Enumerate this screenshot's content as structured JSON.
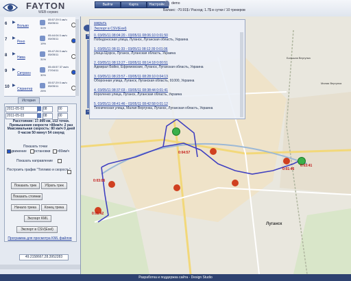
{
  "header": {
    "brand": "FAYTON",
    "brand_sub": "WEB-сервис",
    "nav": [
      "Выйти",
      "Карта",
      "Настройки"
    ],
    "user": "demo",
    "balance": "Баланс: -70.91$ / Расход: 1.7$ в сутки / 10 трекеров"
  },
  "trackers": [
    {
      "num": "6",
      "name": "Вольво",
      "battery": "31%",
      "speed": "05:57:29 0 км/ч 05/05/11"
    },
    {
      "num": "7",
      "name": "Рено",
      "battery": "19%",
      "speed": "05:44:04 0 км/ч 05/05/11"
    },
    {
      "num": "8",
      "name": "Нива",
      "battery": "31%",
      "speed": "05:47:26 0 км/ч 05/05/11"
    },
    {
      "num": "9",
      "name": "Ситроен",
      "battery": "30%",
      "speed": "05:45:57 37 км/ч 27/04/11"
    },
    {
      "num": "10",
      "name": "Спринтер",
      "battery": "25%",
      "speed": "05:57:29 0 км/ч 05/05/11"
    }
  ],
  "history_tab": "История",
  "date_from": "2011-05-03",
  "date_to": "2011-05-03",
  "hour_from": "08",
  "min_from": "00",
  "hour_to": "08",
  "min_to": "00",
  "stats": "Расстояние: 17.999 км, 153 точки. Превышения скорости >80км/ч: 2 раз Максимальная скорость: 80 км/ч 0 дней 0 часов 50 минут 54 секунд",
  "show_points_label": "Показать точки",
  "chk_moving": "движение",
  "chk_stops": "остановки",
  "chk_over80": ">80км/ч",
  "chk_direction": "Показать направление",
  "chk_graph": "Построить график \"Топливо и скорость\"",
  "buttons": {
    "show_track": "Показать трек",
    "hide_track": "Убрать трек",
    "show_stops": "Показать стоянки",
    "track_start": "Начало трека",
    "track_end": "Конец трека",
    "export_kml": "Экспорт KML",
    "export_csv": "Экспорт в CSV(Exel)"
  },
  "kml_link": "Программа для просмотра KML файлов",
  "coords": "49.2158667,28.3952283",
  "popup": {
    "title": "закрыть",
    "export": "Экспорт в CSV(Exel)",
    "trips": [
      {
        "t": "0. 03/05/11 08:04:20 - 03/05/11 08:06:10 0:01:50",
        "addr": "Победоносная улица, Луганск, Луганская область, Украина"
      },
      {
        "t": "1. 03/05/11 08:11:33 - 03/05/11 08:12:39 0:01:06",
        "addr": "улица Щорса, Луганск, Луганская область, Украина"
      },
      {
        "t": "2. 03/05/11 08:13:27 - 03/05/11 08:14:18 0:00:51",
        "addr": "Адмирал Бойко, Ефремовские, Луганск, Луганская область, Украина"
      },
      {
        "t": "3. 03/05/11 08:23:57 - 03/05/11 08:28:10 0:04:13",
        "addr": "Оборонная улица, Луганск, Луганская область, 91000, Украина"
      },
      {
        "t": "4. 03/05/11 08:37:03 - 03/05/11 08:38:44 0:01:41",
        "addr": "Короленко улица, Луганск, Луганская область, Украина"
      },
      {
        "t": "5. 03/05/11 08:41:46 - 03/05/11 08:42:58 0:01:12",
        "addr": "Техническая улица, Малая Вергунка, Луганск, Луганская область, Украина"
      }
    ]
  },
  "map_times": [
    "0:03:06",
    "0:04:57",
    "0:01:46",
    "0:01:42",
    "0:03:41"
  ],
  "map_labels": [
    "Большая Вергунка",
    "Малая Вергунка",
    "Луганск"
  ],
  "footer": "Разработка и поддержка сайта - Design Studio"
}
